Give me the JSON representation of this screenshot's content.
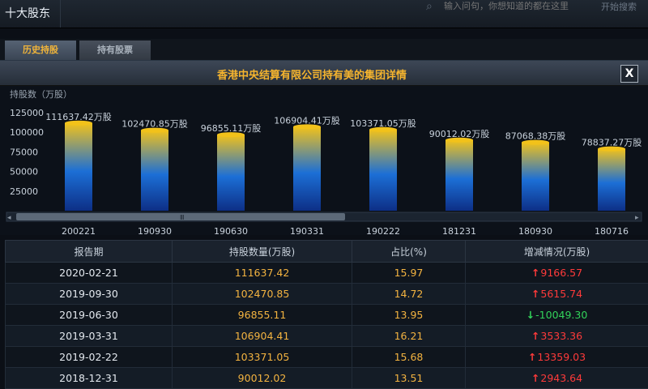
{
  "topbar": {
    "title": "十大股东",
    "search_placeholder": "输入问句，你想知道的都在这里",
    "search_button": "开始搜索"
  },
  "tabs": [
    {
      "label": "历史持股",
      "active": true
    },
    {
      "label": "持有股票",
      "active": false
    }
  ],
  "panel": {
    "title": "香港中央结算有限公司持有美的集团详情",
    "close_label": "X"
  },
  "chart_data": {
    "type": "bar",
    "ylabel": "持股数（万股）",
    "ylim": [
      0,
      130000
    ],
    "yticks": [
      25000,
      50000,
      75000,
      100000,
      125000
    ],
    "categories": [
      "200221",
      "190930",
      "190630",
      "190331",
      "190222",
      "181231",
      "180930",
      "180716"
    ],
    "values": [
      111637.42,
      102470.85,
      96855.11,
      106904.41,
      103371.05,
      90012.02,
      87068.38,
      78837.27
    ],
    "data_labels": [
      "111637.42万股",
      "102470.85万股",
      "96855.11万股",
      "106904.41万股",
      "103371.05万股",
      "90012.02万股",
      "87068.38万股",
      "78837.27万股"
    ],
    "bar_gradient": [
      "#f2c21a",
      "#1c6fd6",
      "#0d2f86"
    ]
  },
  "scrollbar": {
    "thumb_label": "Ⅲ",
    "left_arrow": "◂",
    "right_arrow": "▸"
  },
  "table": {
    "headers": [
      "报告期",
      "持股数量(万股)",
      "占比(%)",
      "增减情况(万股)"
    ],
    "rows": [
      {
        "date": "2020-02-21",
        "qty": "111637.42",
        "pct": "15.97",
        "change": "9166.57",
        "dir": "up"
      },
      {
        "date": "2019-09-30",
        "qty": "102470.85",
        "pct": "14.72",
        "change": "5615.74",
        "dir": "up"
      },
      {
        "date": "2019-06-30",
        "qty": "96855.11",
        "pct": "13.95",
        "change": "-10049.30",
        "dir": "down"
      },
      {
        "date": "2019-03-31",
        "qty": "106904.41",
        "pct": "16.21",
        "change": "3533.36",
        "dir": "up"
      },
      {
        "date": "2019-02-22",
        "qty": "103371.05",
        "pct": "15.68",
        "change": "13359.03",
        "dir": "up"
      },
      {
        "date": "2018-12-31",
        "qty": "90012.02",
        "pct": "13.51",
        "change": "2943.64",
        "dir": "up"
      }
    ]
  },
  "colors": {
    "accent": "#f3b340",
    "up": "#ff3a3a",
    "down": "#32d35a"
  }
}
